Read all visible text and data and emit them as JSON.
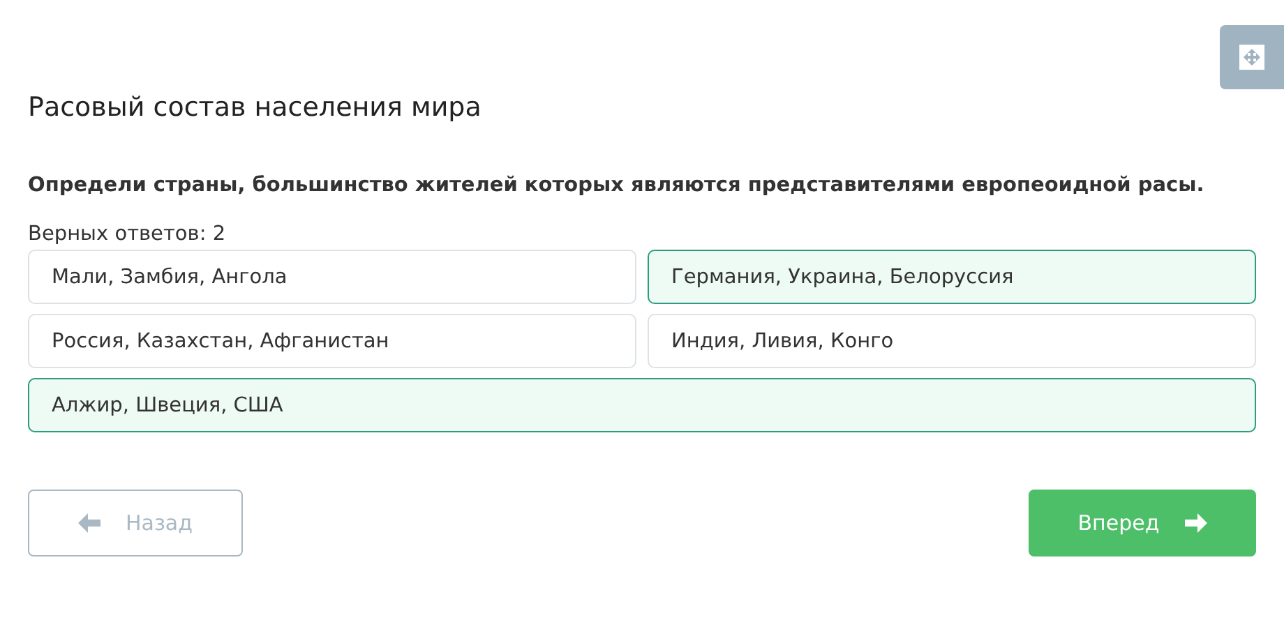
{
  "title": "Расовый состав населения мира",
  "question": "Определи страны, большинство жителей которых являются представителями европеоидной расы.",
  "answer_count": "Верных ответов: 2",
  "options": [
    {
      "label": "Мали, Замбия, Ангола",
      "selected": false
    },
    {
      "label": "Германия, Украина, Белоруссия",
      "selected": true
    },
    {
      "label": "Россия, Казахстан, Афганистан",
      "selected": false
    },
    {
      "label": "Индия, Ливия, Конго",
      "selected": false
    },
    {
      "label": "Алжир, Швеция, США",
      "selected": true
    }
  ],
  "back_button": {
    "label": "Назад",
    "disabled": true
  },
  "next_button": {
    "label": "Вперед",
    "disabled": false
  }
}
